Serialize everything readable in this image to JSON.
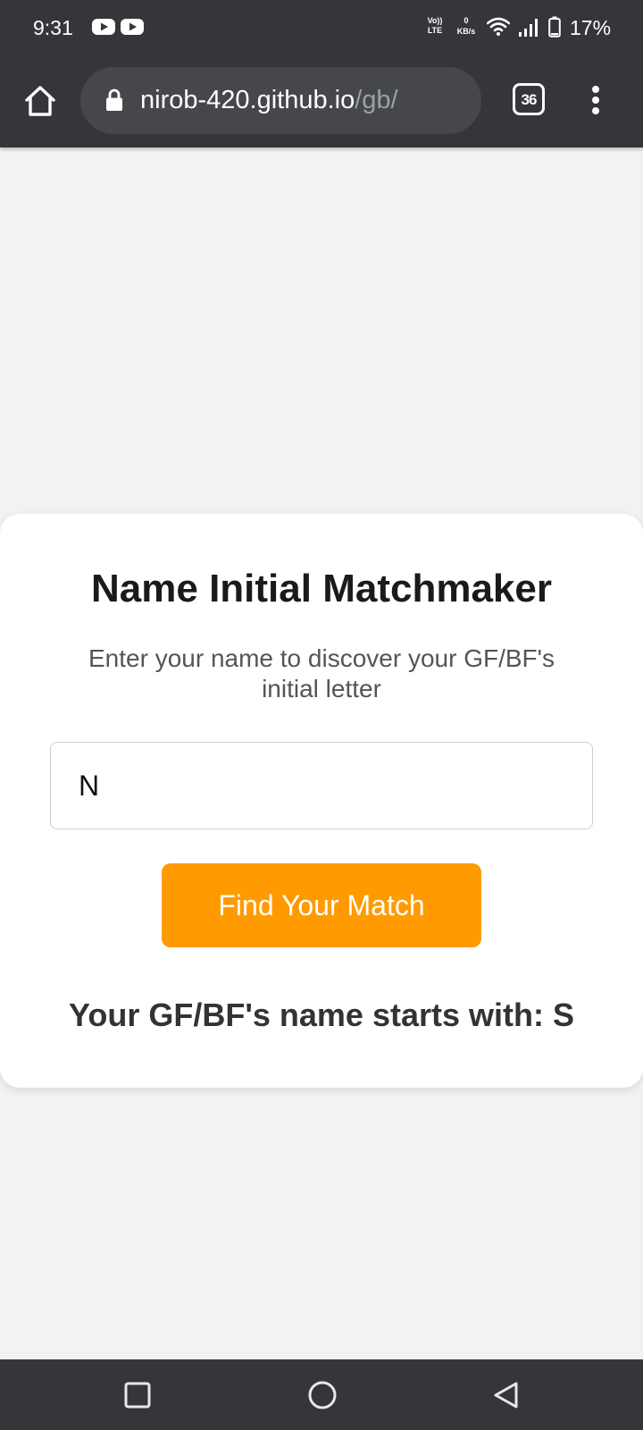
{
  "status_bar": {
    "time": "9:31",
    "notification_icons": [
      "youtube-icon",
      "youtube-icon"
    ],
    "volte_top": "Vo))",
    "volte_bottom": "LTE",
    "net_speed_value": "0",
    "net_speed_unit": "KB/s",
    "battery": "17%"
  },
  "browser": {
    "url_domain": "nirob-420.github.io",
    "url_path": "/gb/",
    "tab_count": "36"
  },
  "card": {
    "title": "Name Initial Matchmaker",
    "subtitle": "Enter your name to discover your GF/BF's initial letter",
    "input_value": "N",
    "button_label": "Find Your Match",
    "result": "Your GF/BF's name starts with: S"
  },
  "colors": {
    "chrome_dark": "#35363a",
    "url_bar": "#46474b",
    "accent_orange": "#ff9b00",
    "page_background": "#f2f2f2",
    "card_background": "#ffffff"
  }
}
